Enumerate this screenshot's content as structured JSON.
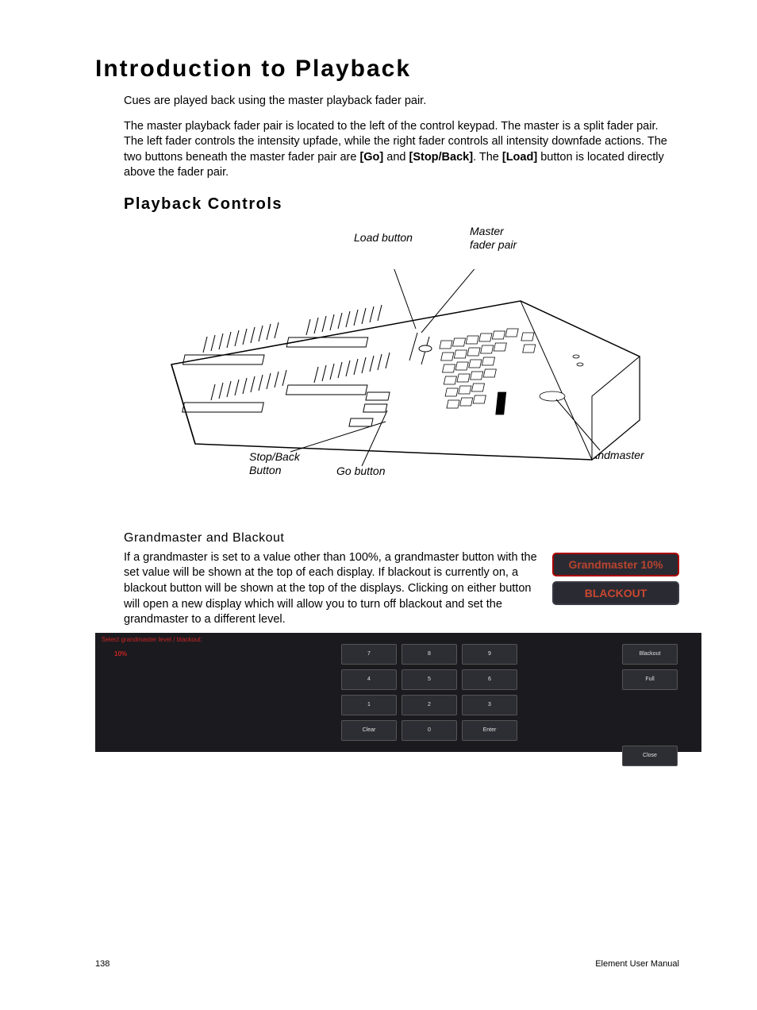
{
  "page": {
    "title": "Introduction to Playback",
    "intro1": "Cues are played back using the master playback fader pair.",
    "intro2_a": "The master playback fader pair is located to the left of the control keypad. The master is a split fader pair. The left fader controls the intensity upfade, while the right fader controls all intensity downfade actions. The two buttons beneath the master fader pair are ",
    "intro2_go": "[Go]",
    "intro2_and": " and ",
    "intro2_stop": "[Stop/Back]",
    "intro2_b": ". The ",
    "intro2_load": "[Load]",
    "intro2_c": " button is located directly above the fader pair."
  },
  "section": {
    "title": "Playback Controls"
  },
  "diagram": {
    "load": "Load button",
    "master": "Master fader pair",
    "stopback": "Stop/Back Button",
    "go": "Go button",
    "grandmaster": "Grandmaster"
  },
  "sub": {
    "title": "Grandmaster and Blackout",
    "body": "If a grandmaster is set to a value other than 100%, a grandmaster button with the set value will be shown at the top of each display. If blackout is currently on, a blackout button will be shown at the top of the displays. Clicking on either button will open a new display which will allow you to turn off blackout and set the grandmaster to a different level."
  },
  "badges": {
    "grandmaster": "Grandmaster 10%",
    "blackout": "BLACKOUT"
  },
  "keypad": {
    "prompt": "Select grandmaster level / blackout:",
    "value": "10%",
    "keys": [
      "7",
      "8",
      "9",
      "4",
      "5",
      "6",
      "1",
      "2",
      "3",
      "Clear",
      "0",
      "Enter"
    ],
    "side": [
      "Blackout",
      "Full",
      "Close"
    ]
  },
  "footer": {
    "page": "138",
    "doc": "Element User Manual"
  }
}
